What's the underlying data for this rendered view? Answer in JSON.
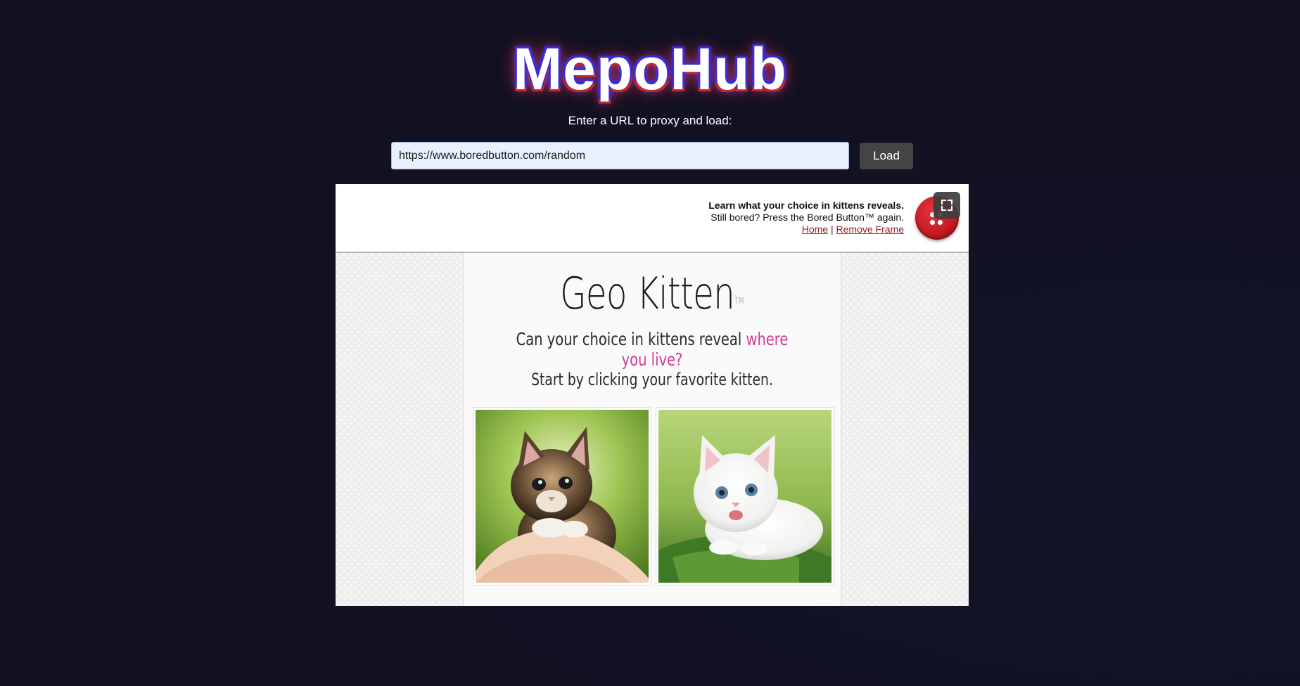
{
  "app": {
    "logo": "MepoHub",
    "prompt": "Enter a URL to proxy and load:",
    "url_value": "https://www.boredbutton.com/random",
    "load_label": "Load"
  },
  "frame": {
    "header": {
      "title": "Learn what your choice in kittens reveals.",
      "subtitle": "Still bored? Press the Bored Button™ again.",
      "link_home": "Home",
      "separator": "|",
      "link_remove": "Remove Frame"
    },
    "content": {
      "title": "Geo Kitten",
      "trademark": "TM",
      "tagline_plain": "Can your choice in kittens reveal ",
      "tagline_highlight": "where you live?",
      "instruction": "Start by clicking your favorite kitten.",
      "kittens": [
        {
          "icon": "tabby-kitten-image"
        },
        {
          "icon": "white-kitten-image"
        }
      ]
    }
  },
  "colors": {
    "background": "#111122",
    "url_field": "#e8f0fe",
    "load_button": "#444444",
    "link": "#a01c1c",
    "tagline_highlight": "#d13c93",
    "bored_button": "#c21a22"
  },
  "icons": {
    "fullscreen": "fullscreen-icon",
    "bored_button": "bored-button-icon"
  }
}
